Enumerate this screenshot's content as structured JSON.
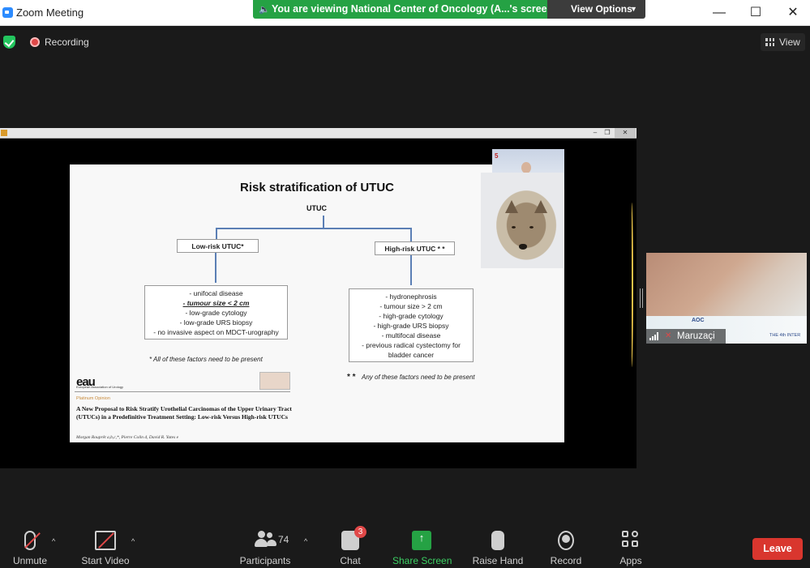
{
  "window": {
    "title": "Zoom Meeting",
    "share_banner": "You are viewing National Center of Oncology (A...'s screen",
    "view_options": "View Options",
    "controls": {
      "minimize": "—",
      "maximize": "☐",
      "close": "✕"
    }
  },
  "meeting_bar": {
    "recording_label": "Recording",
    "view_label": "View"
  },
  "slide": {
    "title": "Risk stratification of UTUC",
    "root": "UTUC",
    "low_risk": {
      "label": "Low-risk UTUC*",
      "factors": [
        "- unifocal disease",
        "- tumour size < 2 cm",
        "- low-grade cytology",
        "- low-grade URS biopsy",
        "- no invasive aspect on MDCT-urography"
      ],
      "note": "* All of these factors need to be present"
    },
    "high_risk": {
      "label": "High-risk UTUC * *",
      "factors": [
        "- hydronephrosis",
        "- tumour size > 2 cm",
        "- high-grade cytology",
        "- high-grade URS biopsy",
        "- multifocal disease",
        "- previous radical cystectomy for",
        "bladder cancer"
      ],
      "note_star": "* *",
      "note": "Any of these factors need to be present"
    },
    "logo": "eau",
    "logo_sub": "European Association of Urology",
    "section": "Platinum Opinion",
    "paper_title": "A New Proposal to Risk Stratify Urothelial Carcinomas of the Upper Urinary Tract (UTUCs) in a Predefinitive Treatment Setting: Low-risk Versus High-risk UTUCs",
    "authors": "Morgan Rouprêt a,b,c,*, Pierre Colin d, David R. Yates e"
  },
  "pip": {
    "logo_text": "5"
  },
  "participant": {
    "name": "Maruzaçi",
    "banner_brand": "AOC",
    "banner_text": "THE 4th INTER"
  },
  "toolbar": {
    "unmute": "Unmute",
    "start_video": "Start Video",
    "participants": "Participants",
    "participants_count": "74",
    "chat": "Chat",
    "chat_badge": "3",
    "share_screen": "Share Screen",
    "raise_hand": "Raise Hand",
    "record": "Record",
    "apps": "Apps",
    "leave": "Leave"
  },
  "colors": {
    "share_green": "#25a244",
    "leave_red": "#d9362e",
    "background": "#1a1a1a",
    "annotation": "#e9c349"
  }
}
